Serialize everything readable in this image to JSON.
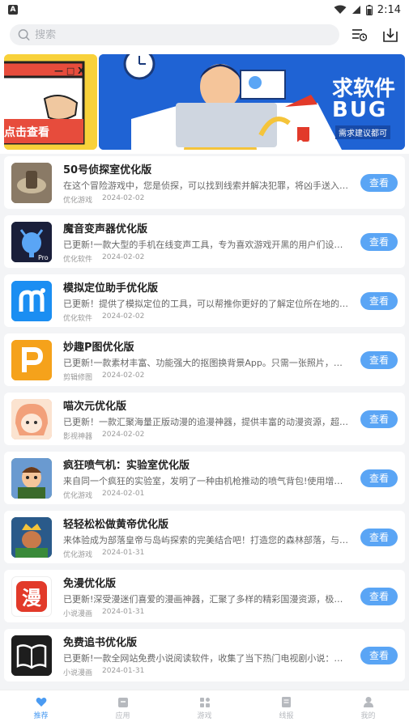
{
  "status": {
    "time": "2:14"
  },
  "search": {
    "placeholder": "搜索"
  },
  "view_label": "查看",
  "banner": {
    "left_text": "点击查看",
    "main_title_1": "求软件",
    "main_title_2": "BUG",
    "main_sub": "需求建议都可",
    "dots": 5,
    "active_dot": 2
  },
  "apps": [
    {
      "title": "50号侦探室优化版",
      "desc": "在这个冒险游戏中，您是侦探，可以找到线索并解决犯罪，将凶手送入监狱!…",
      "category": "优化游戏",
      "date": "2024-02-02",
      "icon": "detective-icon",
      "color": "#7a6a58"
    },
    {
      "title": "魔音变声器优化版",
      "desc": "已更新!一款大型的手机在线变声工具，专为喜欢游戏开黑的用户们设计，用户…",
      "category": "优化软件",
      "date": "2024-02-02",
      "icon": "voice-changer-icon",
      "color": "#1a1f3a"
    },
    {
      "title": "模拟定位助手优化版",
      "desc": "已更新！提供了模拟定位的工具，可以帮推你更好的了解定位所在地的各种的…",
      "category": "优化软件",
      "date": "2024-02-02",
      "icon": "location-icon",
      "color": "#1b8ef2"
    },
    {
      "title": "妙趣P图优化版",
      "desc": "已更新!一款素材丰富、功能强大的抠图换背景App。只需一张照片，就能快速…",
      "category": "剪辑修图",
      "date": "2024-02-02",
      "icon": "photo-edit-icon",
      "color": "#f5a21b"
    },
    {
      "title": "喵次元优化版",
      "desc": "已更新！一款汇聚海量正版动漫的追漫神器，提供丰富的动漫资源，超多动漫…",
      "category": "影视神器",
      "date": "2024-02-02",
      "icon": "anime-icon",
      "color": "#f2a07a"
    },
    {
      "title": "疯狂喷气机：实验室优化版",
      "desc": "来自同一个疯狂的实验室，发明了一种由机枪推动的喷气背包!使用增压车辆…",
      "category": "优化游戏",
      "date": "2024-02-01",
      "icon": "jetpack-icon",
      "color": "#4a7a3a"
    },
    {
      "title": "轻轻松松做黄帝优化版",
      "desc": "来体验成为部落皇帝与岛屿探索的完美结合吧！打造您的森林部落，与石器村…",
      "category": "优化游戏",
      "date": "2024-01-31",
      "icon": "emperor-icon",
      "color": "#2a6a3a"
    },
    {
      "title": "免漫优化版",
      "desc": "已更新!深受漫迷们喜爱的漫画神器，汇聚了多样的精彩国漫资源，极速的更新…",
      "category": "小说漫画",
      "date": "2024-01-31",
      "icon": "manga-icon",
      "color": "#e23a2a",
      "glyph": "漫"
    },
    {
      "title": "免费追书优化版",
      "desc": "已更新!一款全网站免费小说阅读软件，收集了当下热门电视剧小说：白鹿原，…",
      "category": "小说漫画",
      "date": "2024-01-31",
      "icon": "book-icon",
      "color": "#1e1e1e"
    }
  ],
  "nav": [
    {
      "label": "推荐",
      "icon": "heart-icon",
      "active": true
    },
    {
      "label": "应用",
      "icon": "app-icon",
      "active": false
    },
    {
      "label": "游戏",
      "icon": "game-icon",
      "active": false
    },
    {
      "label": "线报",
      "icon": "news-icon",
      "active": false
    },
    {
      "label": "我的",
      "icon": "user-icon",
      "active": false
    }
  ],
  "colors": {
    "accent": "#4a9bf2",
    "button": "#5aa5f5",
    "banner_blue": "#1f63d4",
    "banner_yellow": "#f8d13a"
  }
}
